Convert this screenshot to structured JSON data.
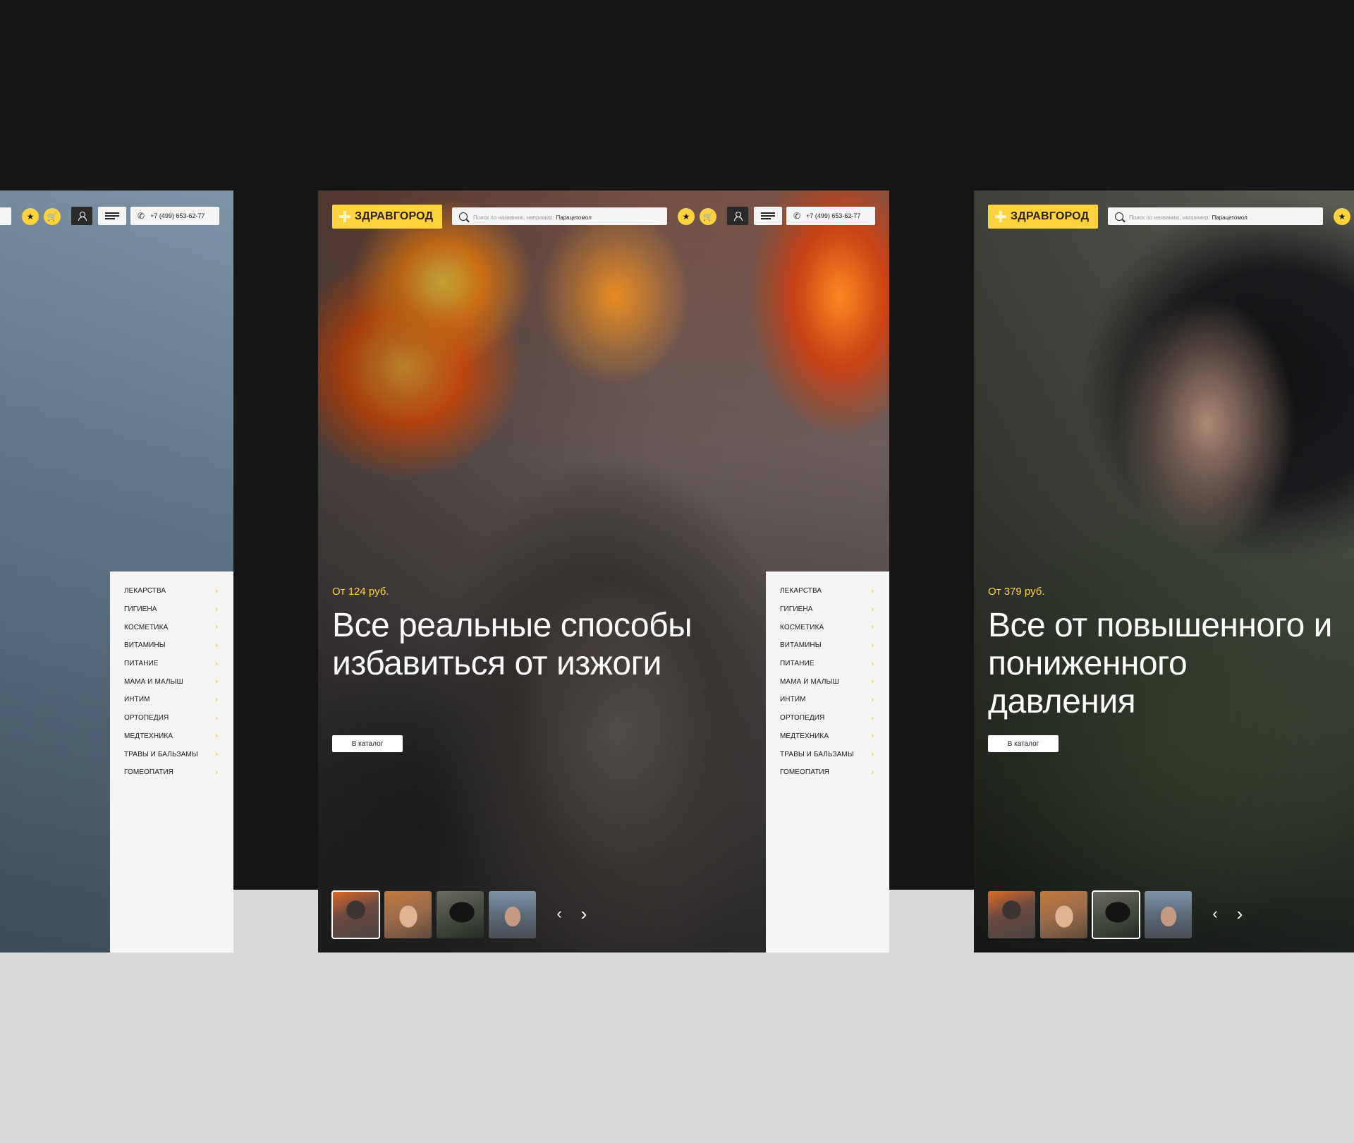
{
  "brand": {
    "logo": "ЗДРАВГОРОД",
    "accent": "#ffd33d"
  },
  "header": {
    "search_placeholder": "Поиск по названию, например:",
    "search_example": "Парацетомол",
    "phone": "+7 (499) 653-62-77",
    "icons": {
      "favorites": "star-icon",
      "cart": "cart-icon",
      "account": "user-icon",
      "menu": "hamburger-menu-icon",
      "phone": "phone-icon"
    }
  },
  "catalog": {
    "items": [
      {
        "label": "ЛЕКАРСТВА"
      },
      {
        "label": "ГИГИЕНА"
      },
      {
        "label": "КОСМЕТИКА"
      },
      {
        "label": "ВИТАМИНЫ"
      },
      {
        "label": "ПИТАНИЕ"
      },
      {
        "label": "МАМА И МАЛЫШ"
      },
      {
        "label": "ИНТИМ"
      },
      {
        "label": "ОРТОПЕДИЯ"
      },
      {
        "label": "МЕДТЕХНИКА"
      },
      {
        "label": "ТРАВЫ И БАЛЬЗАМЫ"
      },
      {
        "label": "ГОМЕОПАТИЯ"
      }
    ]
  },
  "slides": [
    {
      "price": "От 124 руб.",
      "title": "Все реальные способы избавиться от изжоги",
      "cta": "В каталог"
    },
    {
      "price": "От 379 руб.",
      "title": "Все от повышенного и пониженного давления",
      "cta": "В каталог"
    }
  ],
  "slider": {
    "prev": "‹",
    "next": "›"
  }
}
